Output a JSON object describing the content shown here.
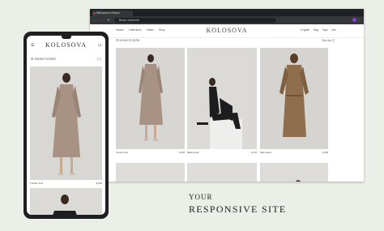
{
  "browser": {
    "tab_title": "Welcome to Bravo",
    "url_site": "Bravo",
    "url_path": "/welcome",
    "nav_buttons": "← → ↻ ⌂",
    "toolbar_right": "⋮"
  },
  "site": {
    "logo": "KOLOSOVA",
    "nav": [
      "Новое",
      "Collections",
      "Studio",
      "Shop"
    ],
    "right_links": [
      "English",
      "Bag",
      "Sign",
      "Info"
    ],
    "show_filters": "SHOW FILTERS",
    "sort_label": "Sort by",
    "products": [
      {
        "name": "Trench coat",
        "price": "$ 254"
      },
      {
        "name": "Black dress",
        "price": "$ 176"
      },
      {
        "name": "Satin dress",
        "price": "$ 230"
      }
    ]
  },
  "mobile": {
    "logo": "KOLOSOVA",
    "menu_icon": "☰",
    "bag_icon": "⊔",
    "show_filters": "SHOW FILTERS",
    "view_toggle": "▯ ▯",
    "product": {
      "name": "Trench coat",
      "price": "$ 254"
    }
  },
  "tagline": {
    "line1": "YOUR",
    "line2": "RESPONSIVE SITE"
  },
  "colors": {
    "background": "#eceee8",
    "browser_chrome": "#202124",
    "phone_body": "#1d1f22",
    "trench": "#a89284",
    "black_dress": "#1d1d1f",
    "satin": "#8e6e4d",
    "photo_bg": "#d9d7d5"
  }
}
